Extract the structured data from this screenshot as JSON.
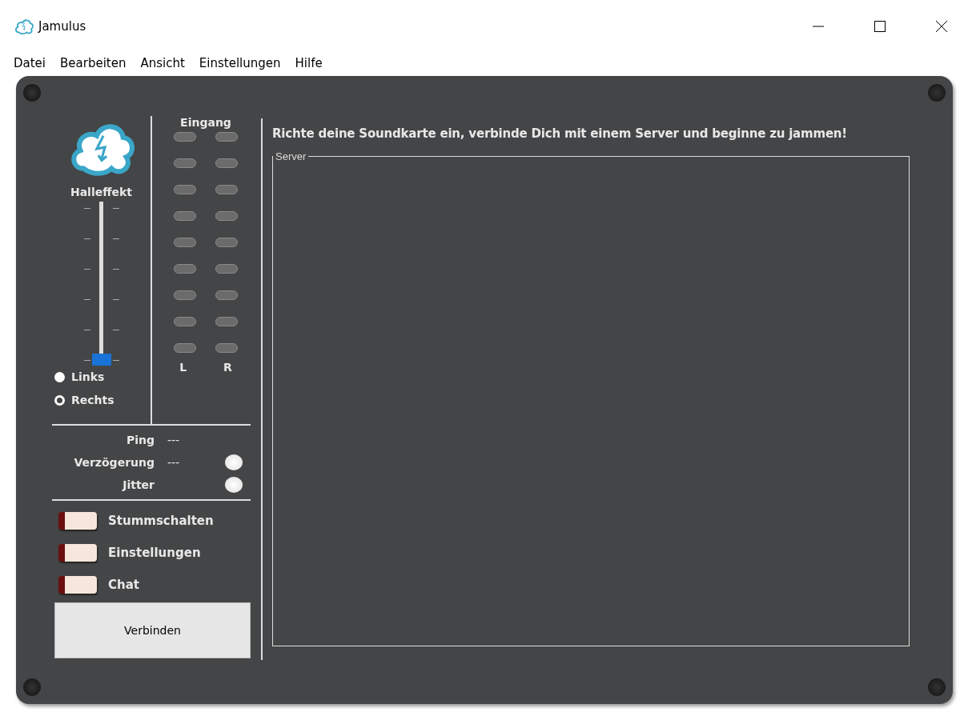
{
  "window": {
    "title": "Jamulus"
  },
  "menu": [
    "Datei",
    "Bearbeiten",
    "Ansicht",
    "Einstellungen",
    "Hilfe"
  ],
  "reverb": {
    "label": "Halleffekt",
    "level": 0
  },
  "channel_select": [
    {
      "label": "Links",
      "selected": true
    },
    {
      "label": "Rechts",
      "selected": false
    }
  ],
  "input_meter": {
    "title": "Eingang",
    "channels": [
      {
        "label": "L"
      },
      {
        "label": "R"
      }
    ]
  },
  "stats": [
    {
      "label": "Ping",
      "value": "---",
      "led": false
    },
    {
      "label": "Verzögerung",
      "value": "---",
      "led": true
    },
    {
      "label": "Jitter",
      "led": true
    }
  ],
  "toggles": [
    {
      "label": "Stummschalten",
      "checked": false
    },
    {
      "label": "Einstellungen",
      "checked": false
    },
    {
      "label": "Chat",
      "checked": false
    }
  ],
  "connect_button": "Verbinden",
  "welcome": "Richte deine Soundkarte ein, verbinde Dich mit einem Server und beginne zu jammen!",
  "server_group": {
    "title": "Server"
  }
}
